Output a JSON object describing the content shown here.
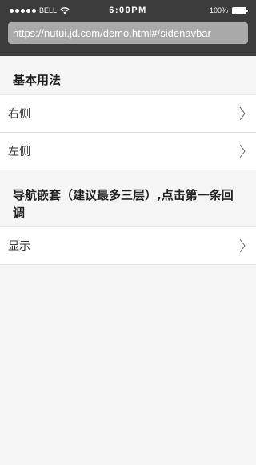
{
  "status_bar": {
    "carrier": "BELL",
    "time": "6:00PM",
    "battery": "100%"
  },
  "address_bar": {
    "url": "https://nutui.jd.com/demo.html#/sidenavbar"
  },
  "sections": [
    {
      "title": "基本用法",
      "items": [
        {
          "label": "右侧"
        },
        {
          "label": "左侧"
        }
      ]
    },
    {
      "title": "导航嵌套（建议最多三层）,点击第一条回调",
      "items": [
        {
          "label": "显示"
        }
      ]
    }
  ]
}
